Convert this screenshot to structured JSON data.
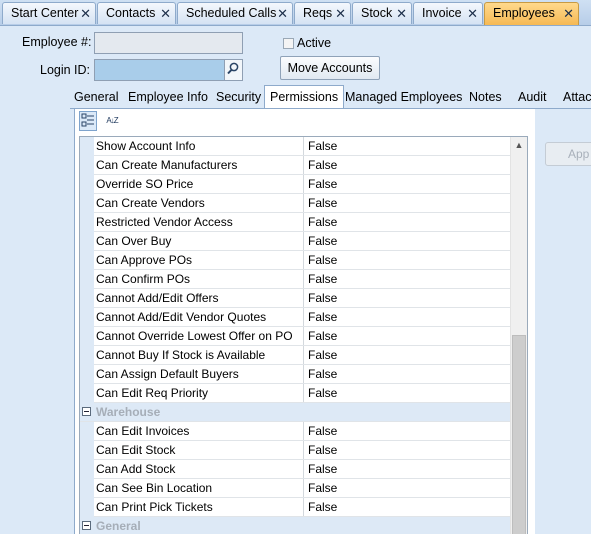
{
  "doc_tabs": [
    {
      "label": "Start Center",
      "active": false
    },
    {
      "label": "Contacts",
      "active": false
    },
    {
      "label": "Scheduled Calls",
      "active": false
    },
    {
      "label": "Reqs",
      "active": false
    },
    {
      "label": "Stock",
      "active": false
    },
    {
      "label": "Invoice",
      "active": false
    },
    {
      "label": "Employees",
      "active": true
    }
  ],
  "form": {
    "employee_num_label": "Employee #:",
    "employee_num_value": "",
    "login_id_label": "Login ID:",
    "login_id_value": "",
    "active_label": "Active",
    "active_checked": false,
    "move_accounts_label": "Move Accounts",
    "apply_label": "App"
  },
  "sub_tabs": [
    {
      "label": "General",
      "active": false
    },
    {
      "label": "Employee Info",
      "active": false
    },
    {
      "label": "Security",
      "active": false
    },
    {
      "label": "Permissions",
      "active": true
    },
    {
      "label": "Managed Employees",
      "active": false
    },
    {
      "label": "Notes",
      "active": false
    },
    {
      "label": "Audit",
      "active": false
    },
    {
      "label": "Attac",
      "active": false
    }
  ],
  "toolbar": {
    "categorized_icon": "categorized-icon",
    "alphabetical_icon": "sort-alphabetical-icon",
    "alphabetical_glyph": "A↓Z"
  },
  "grid": {
    "rows": [
      {
        "type": "prop",
        "name": "Show Account Info",
        "value": "False"
      },
      {
        "type": "prop",
        "name": "Can Create Manufacturers",
        "value": "False"
      },
      {
        "type": "prop",
        "name": "Override SO Price",
        "value": "False"
      },
      {
        "type": "prop",
        "name": "Can Create Vendors",
        "value": "False"
      },
      {
        "type": "prop",
        "name": "Restricted Vendor Access",
        "value": "False"
      },
      {
        "type": "prop",
        "name": "Can Over Buy",
        "value": "False"
      },
      {
        "type": "prop",
        "name": "Can Approve POs",
        "value": "False"
      },
      {
        "type": "prop",
        "name": "Can Confirm POs",
        "value": "False"
      },
      {
        "type": "prop",
        "name": "Cannot Add/Edit Offers",
        "value": "False"
      },
      {
        "type": "prop",
        "name": "Cannot Add/Edit Vendor Quotes",
        "value": "False"
      },
      {
        "type": "prop",
        "name": "Cannot Override Lowest Offer on PO",
        "value": "False"
      },
      {
        "type": "prop",
        "name": "Cannot Buy If Stock is Available",
        "value": "False"
      },
      {
        "type": "prop",
        "name": "Can Assign Default Buyers",
        "value": "False"
      },
      {
        "type": "prop",
        "name": "Can Edit Req Priority",
        "value": "False"
      },
      {
        "type": "category",
        "name": "Warehouse"
      },
      {
        "type": "prop",
        "name": "Can Edit Invoices",
        "value": "False"
      },
      {
        "type": "prop",
        "name": "Can Edit Stock",
        "value": "False"
      },
      {
        "type": "prop",
        "name": "Can Add Stock",
        "value": "False"
      },
      {
        "type": "prop",
        "name": "Can See Bin Location",
        "value": "False"
      },
      {
        "type": "prop",
        "name": "Can Print Pick Tickets",
        "value": "False"
      },
      {
        "type": "category",
        "name": "General"
      }
    ]
  },
  "colors": {
    "active_tab": "#f6b954",
    "background": "#dce9f7",
    "category_row": "#dde9f6",
    "login_field": "#a9cdea"
  }
}
